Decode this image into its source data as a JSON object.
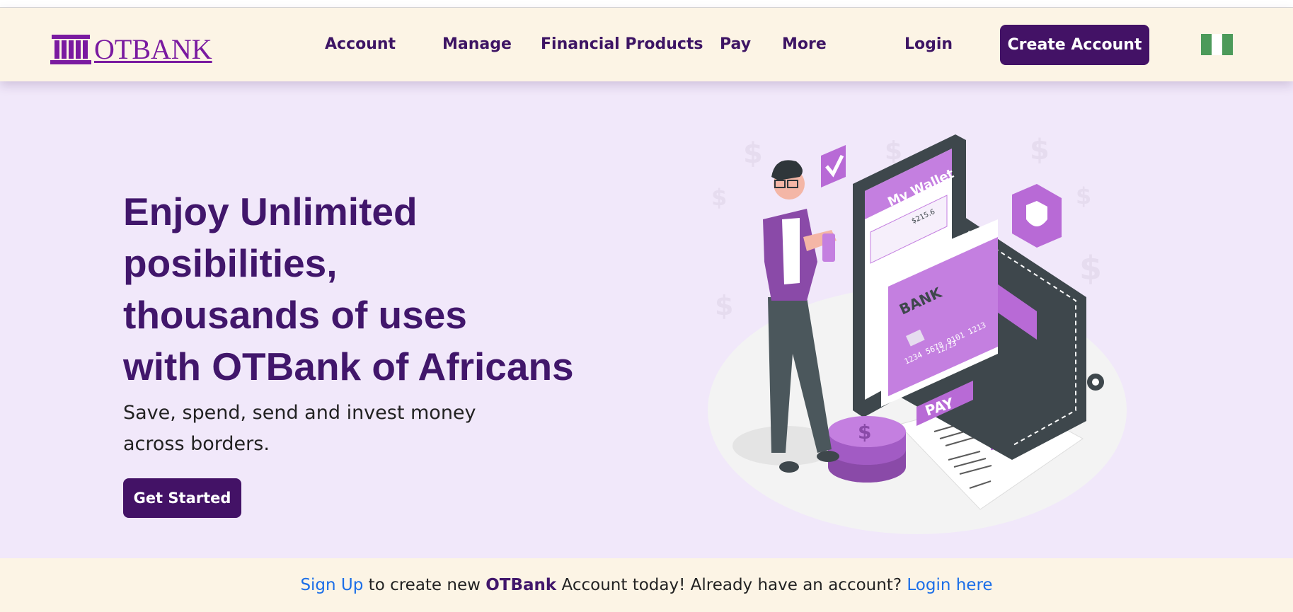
{
  "header": {
    "logo_text": "OTBANK",
    "nav": {
      "account": "Account",
      "manage": "Manage",
      "financial_products": "Financial Products",
      "pay": "Pay",
      "more": "More",
      "login": "Login"
    },
    "create_account": "Create Account"
  },
  "hero": {
    "title_lines": [
      "Enjoy Unlimited",
      "posibilities,",
      "thousands of uses",
      "with OTBank of Africans"
    ],
    "subtitle": "Save, spend, send and invest money across borders.",
    "cta": "Get Started"
  },
  "illustration": {
    "wallet_title": "My Wallet",
    "wallet_amount": "$215.6",
    "card_bank": "BANK",
    "card_number": "1234 5678 9101 1213",
    "card_expiry": "12/23",
    "pay_label": "PAY"
  },
  "footer": {
    "signup_link": "Sign Up",
    "text1": " to create new ",
    "brand": "OTBank",
    "text2": " Account today! Already have an account? ",
    "login_link": "Login here"
  },
  "colors": {
    "primary": "#431266",
    "title": "#41166b",
    "hero_bg": "#f1e8fa",
    "nav_bg": "#fcf4e5",
    "link": "#1b6ee8",
    "accent": "#b86ad6"
  }
}
